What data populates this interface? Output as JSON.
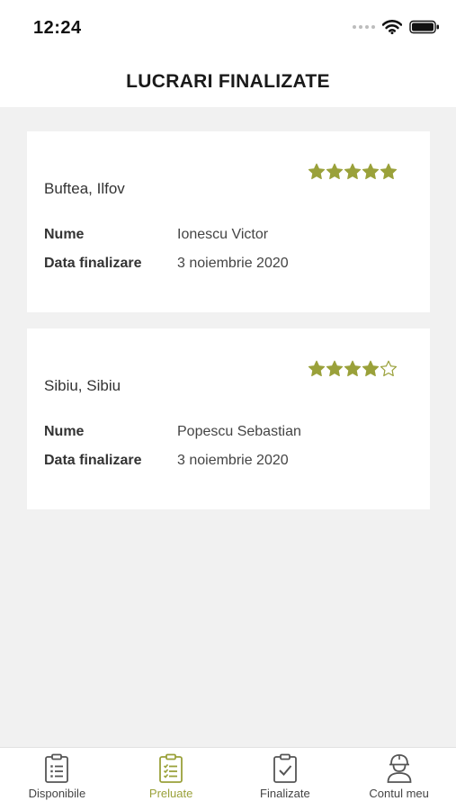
{
  "status_bar": {
    "time": "12:24"
  },
  "header": {
    "title": "LUCRARI FINALIZATE"
  },
  "colors": {
    "accent": "#9aa13a",
    "background": "#f1f1f1"
  },
  "jobs": [
    {
      "location": "Buftea, Ilfov",
      "rating": 5,
      "name_label": "Nume",
      "name": "Ionescu Victor",
      "date_label": "Data finalizare",
      "date": "3 noiembrie 2020"
    },
    {
      "location": "Sibiu, Sibiu",
      "rating": 4,
      "name_label": "Nume",
      "name": "Popescu Sebastian",
      "date_label": "Data finalizare",
      "date": "3 noiembrie 2020"
    }
  ],
  "tabs": [
    {
      "label": "Disponibile",
      "icon": "clipboard-list-icon",
      "active": false
    },
    {
      "label": "Preluate",
      "icon": "clipboard-checklist-icon",
      "active": true
    },
    {
      "label": "Finalizate",
      "icon": "clipboard-check-icon",
      "active": false
    },
    {
      "label": "Contul meu",
      "icon": "worker-helmet-icon",
      "active": false
    }
  ]
}
